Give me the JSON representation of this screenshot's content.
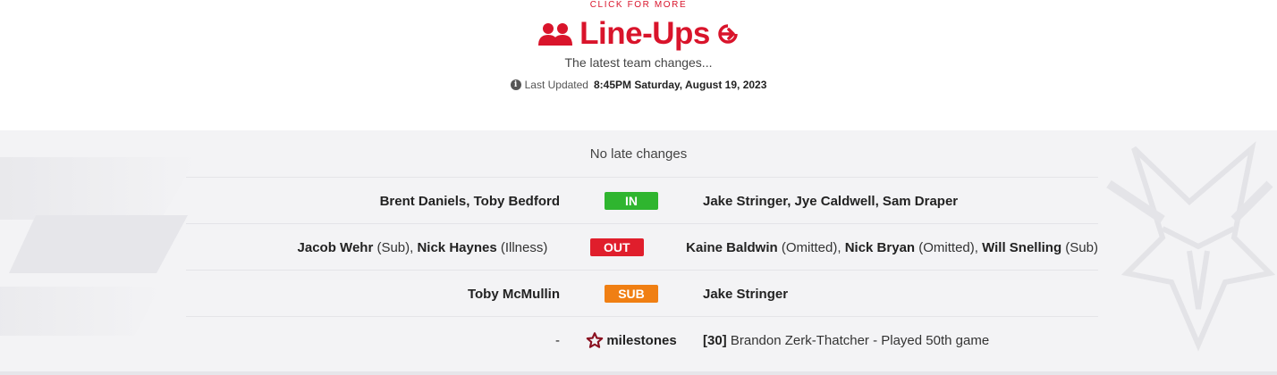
{
  "header": {
    "click_more": "CLICK FOR MORE",
    "title": "Line-Ups",
    "subtitle": "The latest team changes...",
    "updated_label": "Last Updated",
    "updated_value": "8:45PM Saturday, August 19, 2023",
    "accent_color": "#d9142b"
  },
  "panel": {
    "no_changes": "No late changes",
    "rows": [
      {
        "badge": "IN",
        "badge_color": "#2fb52f",
        "left": [
          {
            "text": "Brent Daniels, Toby Bedford",
            "bold": true
          }
        ],
        "right": [
          {
            "text": "Jake Stringer, Jye Caldwell, Sam Draper",
            "bold": true
          }
        ]
      },
      {
        "badge": "OUT",
        "badge_color": "#e01e2c",
        "left": [
          {
            "text": "Jacob Wehr",
            "bold": true
          },
          {
            "text": " (Sub), ",
            "bold": false
          },
          {
            "text": "Nick Haynes",
            "bold": true
          },
          {
            "text": " (Illness)",
            "bold": false
          }
        ],
        "right": [
          {
            "text": "Kaine Baldwin",
            "bold": true
          },
          {
            "text": " (Omitted), ",
            "bold": false
          },
          {
            "text": "Nick Bryan",
            "bold": true
          },
          {
            "text": " (Omitted), ",
            "bold": false
          },
          {
            "text": "Will Snelling",
            "bold": true
          },
          {
            "text": " (Sub)",
            "bold": false
          }
        ]
      },
      {
        "badge": "SUB",
        "badge_color": "#f07f13",
        "left": [
          {
            "text": "Toby McMullin",
            "bold": true
          }
        ],
        "right": [
          {
            "text": "Jake Stringer",
            "bold": true
          }
        ]
      }
    ],
    "milestones": {
      "left": "-",
      "label": "milestones",
      "icon": "star-icon",
      "icon_color": "#8a1020",
      "number": "[30]",
      "text": " Brandon Zerk-Thatcher - Played 50th game"
    }
  }
}
